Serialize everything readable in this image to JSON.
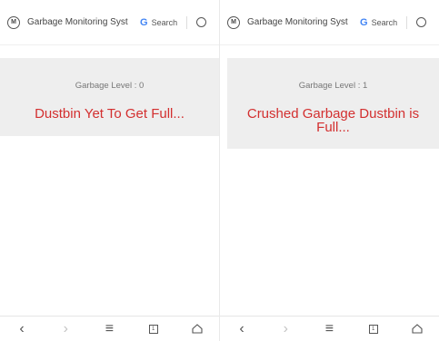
{
  "left": {
    "url_title": "Garbage Monitoring Syst",
    "search_label": "Search",
    "level_text": "Garbage Level : 0",
    "status_text": "Dustbin Yet To Get Full..."
  },
  "right": {
    "url_title": "Garbage Monitoring Syst",
    "search_label": "Search",
    "level_text": "Garbage Level : 1",
    "status_text": "Crushed Garbage Dustbin is Full..."
  },
  "tab_count": "1",
  "colors": {
    "status": "#d32f2f",
    "card": "#eeeeee",
    "google_blue": "#4285f4"
  },
  "icons": [
    "site-favicon-icon",
    "google-icon",
    "reload-icon",
    "back-icon",
    "forward-icon",
    "menu-icon",
    "tabs-icon",
    "home-icon"
  ]
}
